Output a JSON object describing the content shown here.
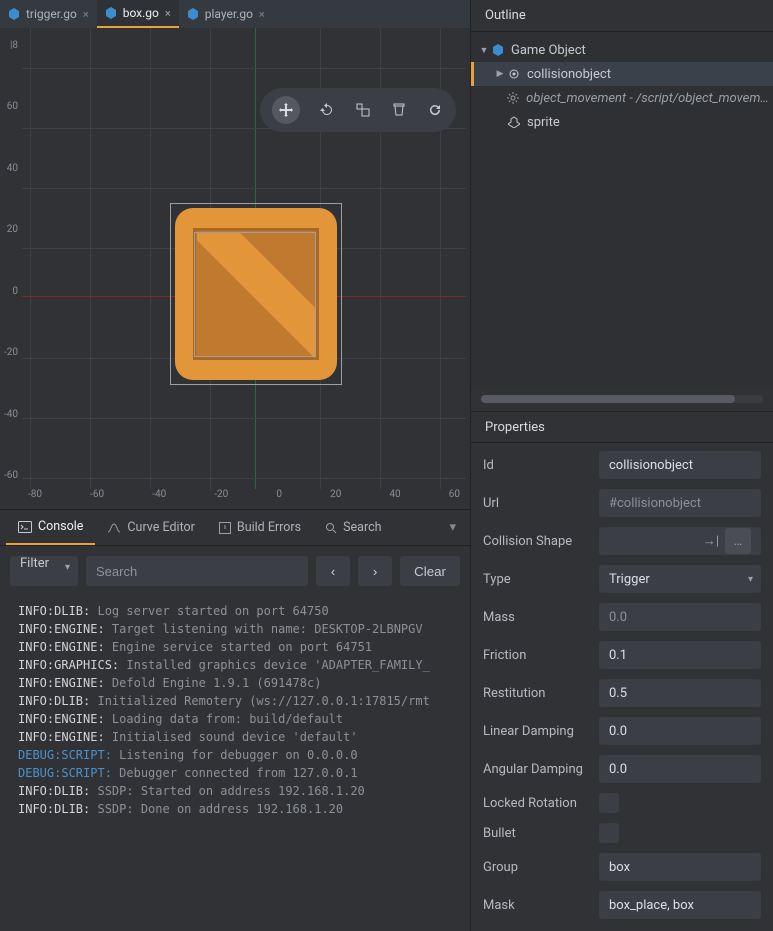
{
  "tabs": [
    {
      "label": "trigger.go",
      "active": false
    },
    {
      "label": "box.go",
      "active": true
    },
    {
      "label": "player.go",
      "active": false
    }
  ],
  "ruler_y": [
    "|8",
    "60",
    "40",
    "20",
    "0",
    "-20",
    "-40",
    "-60"
  ],
  "ruler_x": [
    "-80",
    "-60",
    "-40",
    "-20",
    "0",
    "20",
    "40",
    "60"
  ],
  "viewport_tools": [
    "move-icon",
    "rotate-icon",
    "scale-icon",
    "erase-icon",
    "refresh-icon"
  ],
  "bottom_tabs": {
    "console": "Console",
    "curve": "Curve Editor",
    "errors": "Build Errors",
    "search": "Search"
  },
  "console_toolbar": {
    "filter_label": "Filter",
    "search_placeholder": "Search",
    "clear_label": "Clear"
  },
  "console": [
    {
      "tag": "INFO:DLIB:",
      "msg": " Log server started on port 64750"
    },
    {
      "tag": "INFO:ENGINE:",
      "msg": " Target listening with name: DESKTOP-2LBNPGV"
    },
    {
      "tag": "INFO:ENGINE:",
      "msg": " Engine service started on port 64751"
    },
    {
      "tag": "INFO:GRAPHICS:",
      "msg": " Installed graphics device 'ADAPTER_FAMILY_"
    },
    {
      "tag": "INFO:ENGINE:",
      "msg": " Defold Engine 1.9.1 (691478c)"
    },
    {
      "tag": "INFO:DLIB:",
      "msg": " Initialized Remotery (ws://127.0.0.1:17815/rmt"
    },
    {
      "tag": "INFO:ENGINE:",
      "msg": " Loading data from: build/default"
    },
    {
      "tag": "INFO:ENGINE:",
      "msg": " Initialised sound device 'default'"
    },
    {
      "tag": "DEBUG:SCRIPT:",
      "msg": " Listening for debugger on 0.0.0.0",
      "debug": true
    },
    {
      "tag": "DEBUG:SCRIPT:",
      "msg": " Debugger connected from 127.0.0.1",
      "debug": true
    },
    {
      "tag": "INFO:DLIB:",
      "msg": " SSDP: Started on address 192.168.1.20"
    },
    {
      "tag": "INFO:DLIB:",
      "msg": " SSDP: Done on address 192.168.1.20"
    }
  ],
  "outline": {
    "title": "Outline",
    "root": "Game Object",
    "items": [
      {
        "label": "collisionobject",
        "selected": true,
        "icon": "collision-icon",
        "twist": true
      },
      {
        "label": "object_movement - /script/object_movement.",
        "italic": true,
        "icon": "gear-icon"
      },
      {
        "label": "sprite",
        "icon": "sprite-icon"
      }
    ]
  },
  "properties": {
    "title": "Properties",
    "fields": {
      "id_label": "Id",
      "id_value": "collisionobject",
      "url_label": "Url",
      "url_value": "#collisionobject",
      "shape_label": "Collision Shape",
      "shape_value": "",
      "type_label": "Type",
      "type_value": "Trigger",
      "mass_label": "Mass",
      "mass_value": "0.0",
      "friction_label": "Friction",
      "friction_value": "0.1",
      "restitution_label": "Restitution",
      "restitution_value": "0.5",
      "lindamp_label": "Linear Damping",
      "lindamp_value": "0.0",
      "angdamp_label": "Angular Damping",
      "angdamp_value": "0.0",
      "locked_label": "Locked Rotation",
      "bullet_label": "Bullet",
      "group_label": "Group",
      "group_value": "box",
      "mask_label": "Mask",
      "mask_value": "box_place, box"
    }
  }
}
